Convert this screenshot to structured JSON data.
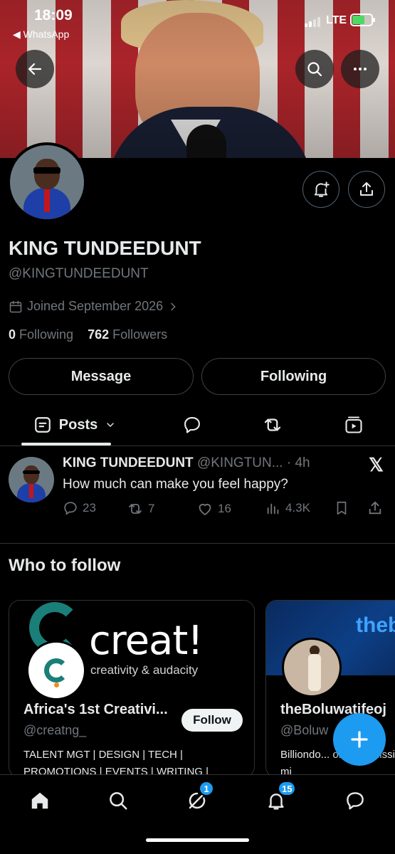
{
  "status_bar": {
    "time": "18:09",
    "back_app": "◀ WhatsApp",
    "network": "LTE"
  },
  "profile": {
    "name": "KING TUNDEEDUNT",
    "handle": "@KINGTUNDEEDUNT",
    "joined": "Joined September 2026",
    "following_count": "0",
    "following_label": "Following",
    "followers_count": "762",
    "followers_label": "Followers"
  },
  "actions": {
    "message_label": "Message",
    "following_label": "Following"
  },
  "tabs": {
    "posts_label": "Posts"
  },
  "tweet": {
    "author": "KING TUNDEEDUNT",
    "handle_time": "@KINGTUN... · 4h",
    "text": "How much can make you feel happy?",
    "replies": "23",
    "reposts": "7",
    "likes": "16",
    "views": "4.3K"
  },
  "who_to_follow": {
    "title": "Who to follow",
    "cards": [
      {
        "cover_word": "creat!",
        "cover_tagline": "creativity & audacity",
        "name": "Africa's 1st Creativi...",
        "handle": "@creatng_",
        "follow_label": "Follow",
        "bio": "TALENT MGT | DESIGN | TECH | PROMOTIONS | EVENTS | WRITING |"
      },
      {
        "cover_word": "theb",
        "name": "theBoluwatifeoj",
        "handle": "@Boluw",
        "bio": "Billiondo... olu and mission mi"
      }
    ]
  },
  "nav": {
    "messages_badge": "1",
    "notifications_badge": "15"
  },
  "colors": {
    "accent": "#1d9bf0",
    "background": "#000000",
    "muted": "#71767b"
  }
}
